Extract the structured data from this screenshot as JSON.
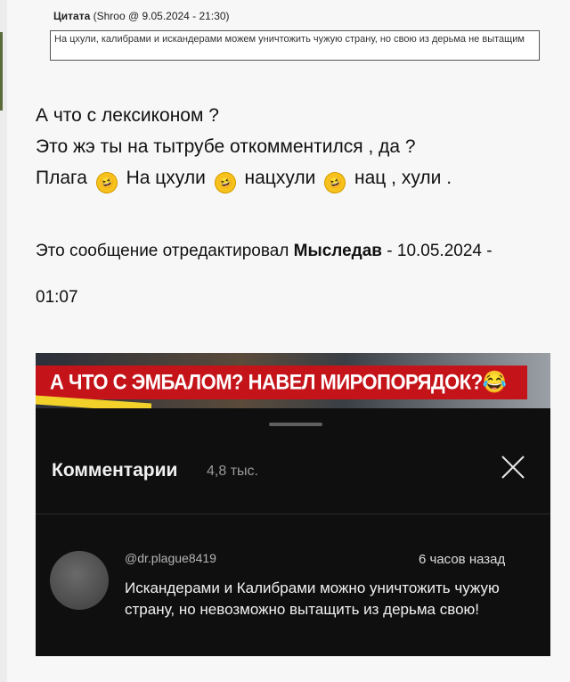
{
  "quote": {
    "label": "Цитата",
    "meta": "(Shroo @ 9.05.2024 - 21:30)",
    "text": "На цхули, калибрами и искандерами можем уничтожить чужую страну, но свою из дерьма не вытащим"
  },
  "message": {
    "line1": "А что с лексиконом ?",
    "line2": "Это жэ ты на тытрубе откомментился , да ?",
    "line3_parts": [
      "Плага",
      "На цхули",
      "нацхули",
      "нац , хули ."
    ],
    "emoji": "rolling-on-floor-laughing"
  },
  "edit": {
    "prefix": "Это сообщение отредактировал",
    "author": "Мыследав",
    "date": "- 10.05.2024 -",
    "time": "01:07"
  },
  "embed": {
    "banner": "А ЧТО С ЭМБАЛОМ? НАВЕЛ МИРОПОРЯДОК?😂",
    "comments_title": "Комментарии",
    "comments_count": "4,8 тыс.",
    "comment": {
      "user": "@dr.plague8419",
      "time": "6 часов назад",
      "text": "Искандерами и Калибрами можно уничтожить чужую страну, но невозможно вытащить из дерьма свою!"
    }
  }
}
